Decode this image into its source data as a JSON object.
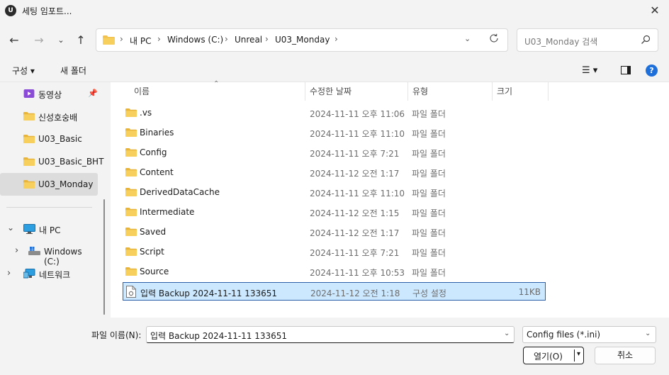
{
  "window": {
    "title": "세팅 임포트...",
    "logo_text": "U",
    "close_glyph": "✕"
  },
  "nav_buttons": {
    "back_glyph": "←",
    "forward_glyph": "→",
    "history_glyph": "⌄",
    "up_glyph": "↑"
  },
  "breadcrumb": [
    "내 PC",
    "Windows (C:)",
    "Unreal",
    "U03_Monday"
  ],
  "breadcrumb_sep": "›",
  "search": {
    "placeholder": "U03_Monday 검색"
  },
  "toolbar": {
    "organize_label": "구성 ▾",
    "new_folder_label": "새 폴더",
    "view_glyph": "☰ ▾",
    "help_glyph": "?"
  },
  "sidebar": {
    "items": [
      {
        "label": "동영상",
        "icon": "video-folder-icon"
      },
      {
        "label": "신성호숭배",
        "icon": "folder-icon"
      },
      {
        "label": "U03_Basic",
        "icon": "folder-icon"
      },
      {
        "label": "U03_Basic_BHT",
        "icon": "folder-icon"
      },
      {
        "label": "U03_Monday",
        "icon": "folder-icon",
        "selected": true
      }
    ],
    "tree": [
      {
        "label": "내 PC",
        "expander": "⌄"
      },
      {
        "label": "Windows (C:)",
        "expander": "›"
      },
      {
        "label": "네트워크",
        "expander": "›"
      }
    ]
  },
  "columns": {
    "name": "이름",
    "modified": "수정한 날짜",
    "type": "유형",
    "size": "크기",
    "sort_glyph": "⌃"
  },
  "files": [
    {
      "name": ".vs",
      "date": "2024-11-11 오후 11:06",
      "type": "파일 폴더",
      "size": "",
      "kind": "folder"
    },
    {
      "name": "Binaries",
      "date": "2024-11-11 오후 11:10",
      "type": "파일 폴더",
      "size": "",
      "kind": "folder"
    },
    {
      "name": "Config",
      "date": "2024-11-11 오후 7:21",
      "type": "파일 폴더",
      "size": "",
      "kind": "folder"
    },
    {
      "name": "Content",
      "date": "2024-11-12 오전 1:17",
      "type": "파일 폴더",
      "size": "",
      "kind": "folder"
    },
    {
      "name": "DerivedDataCache",
      "date": "2024-11-11 오후 11:10",
      "type": "파일 폴더",
      "size": "",
      "kind": "folder"
    },
    {
      "name": "Intermediate",
      "date": "2024-11-12 오전 1:15",
      "type": "파일 폴더",
      "size": "",
      "kind": "folder"
    },
    {
      "name": "Saved",
      "date": "2024-11-12 오전 1:17",
      "type": "파일 폴더",
      "size": "",
      "kind": "folder"
    },
    {
      "name": "Script",
      "date": "2024-11-11 오후 7:21",
      "type": "파일 폴더",
      "size": "",
      "kind": "folder"
    },
    {
      "name": "Source",
      "date": "2024-11-11 오후 10:53",
      "type": "파일 폴더",
      "size": "",
      "kind": "folder"
    },
    {
      "name": "입력 Backup 2024-11-11 133651",
      "date": "2024-11-12 오전 1:18",
      "type": "구성 설정",
      "size": "11KB",
      "kind": "file",
      "selected": true
    }
  ],
  "footer": {
    "filename_label": "파일 이름(N):",
    "filename_value": "입력 Backup 2024-11-11 133651",
    "filter_value": "Config files (*.ini)",
    "open_label": "열기(O)",
    "cancel_label": "취소",
    "dropdown_glyph": "⌄",
    "split_arrow": "▾"
  },
  "colors": {
    "folder": "#f2c14e",
    "folder_dark": "#d9a521",
    "selection_bg": "#cce8ff",
    "selection_border": "#2b5fa8",
    "accent": "#1e6fd9"
  }
}
